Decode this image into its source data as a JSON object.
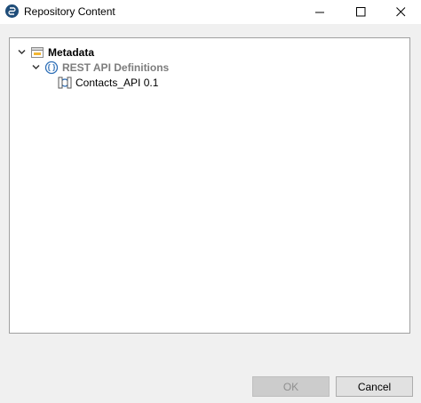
{
  "window": {
    "title": "Repository Content",
    "minimize_glyph": "—",
    "maximize_glyph": "☐",
    "close_glyph": "✕"
  },
  "tree": {
    "root": {
      "label": "Metadata",
      "icon": "metadata-icon",
      "expanded": true
    },
    "child": {
      "label": "REST API Definitions",
      "icon": "rest-api-icon",
      "expanded": true
    },
    "leaf": {
      "label": "Contacts_API 0.1",
      "icon": "api-definition-icon"
    }
  },
  "buttons": {
    "ok": "OK",
    "cancel": "Cancel"
  }
}
